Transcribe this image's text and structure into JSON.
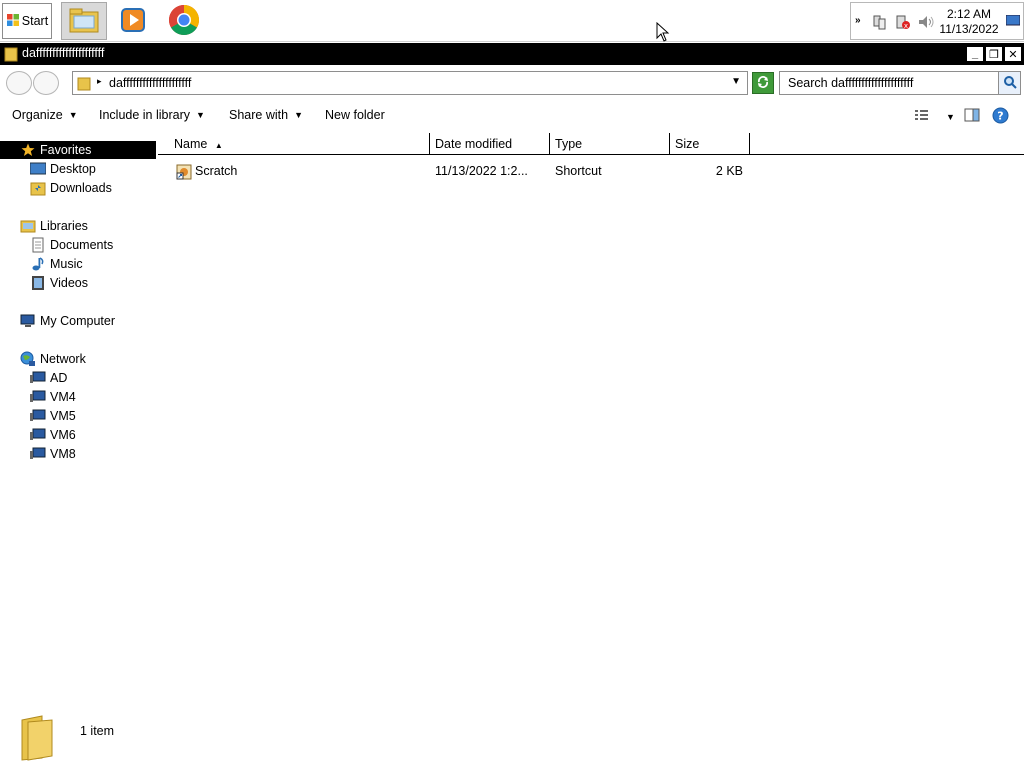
{
  "taskbar": {
    "start_label": "Start",
    "apps": [
      {
        "name": "Windows Explorer",
        "icon": "folder-explorer-icon",
        "active": true
      },
      {
        "name": "Windows Media Player",
        "icon": "media-player-icon",
        "active": false
      },
      {
        "name": "Google Chrome",
        "icon": "chrome-icon",
        "active": false
      }
    ],
    "tray": {
      "time": "2:12 AM",
      "date": "11/13/2022",
      "icons": [
        "chevron-icon",
        "network-icon",
        "action-center-icon",
        "volume-icon",
        "show-desktop-icon"
      ]
    }
  },
  "window": {
    "title": "dafffffffffffffffffffff",
    "controls": {
      "minimize": "_",
      "restore": "❐",
      "close": "✕"
    }
  },
  "address": {
    "path": "dafffffffffffffffffffff",
    "search_placeholder": "Search dafffffffffffffffffffff"
  },
  "toolbar": {
    "organize": "Organize",
    "include_in_library": "Include in library",
    "share_with": "Share with",
    "new_folder": "New folder"
  },
  "nav": {
    "favorites": "Favorites",
    "desktop": "Desktop",
    "downloads": "Downloads",
    "libraries": "Libraries",
    "documents": "Documents",
    "music": "Music",
    "videos": "Videos",
    "my_computer": "My Computer",
    "network": "Network",
    "hosts": [
      "AD",
      "VM4",
      "VM5",
      "VM6",
      "VM8"
    ]
  },
  "columns": {
    "name": "Name",
    "date_modified": "Date modified",
    "type": "Type",
    "size": "Size"
  },
  "files": [
    {
      "name": "Scratch",
      "date_modified": "11/13/2022 1:2...",
      "type": "Shortcut",
      "size": "2 KB"
    }
  ],
  "status": {
    "item_count": "1 item"
  },
  "colors": {
    "titlebar": "#000000",
    "selection": "#000000",
    "folder": "#e8c34a"
  }
}
